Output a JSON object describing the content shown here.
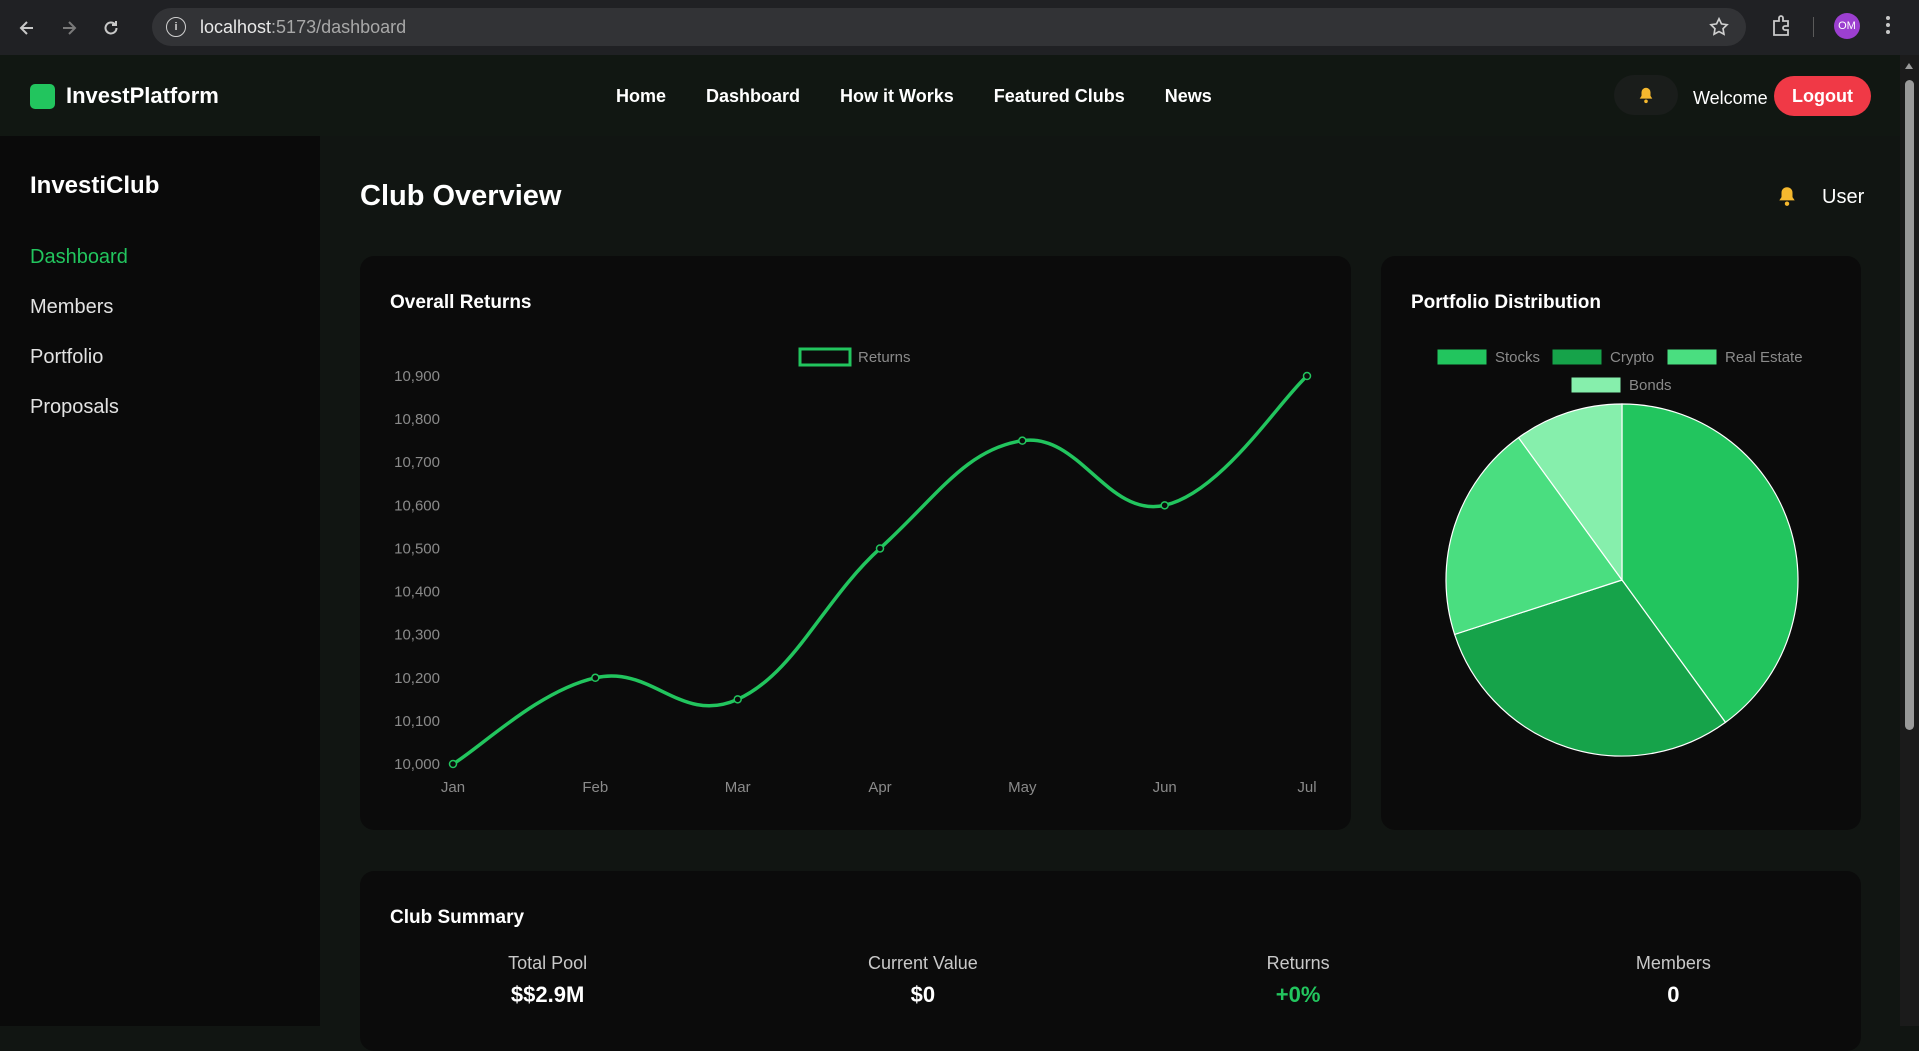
{
  "browser": {
    "url_host": "localhost",
    "url_path": ":5173/dashboard",
    "avatar_initials": "OM"
  },
  "topbar": {
    "brand": "InvestPlatform",
    "nav": [
      "Home",
      "Dashboard",
      "How it Works",
      "Featured Clubs",
      "News"
    ],
    "welcome": "Welcome",
    "logout": "Logout"
  },
  "sidebar": {
    "title": "InvestiClub",
    "items": [
      {
        "label": "Dashboard",
        "active": true
      },
      {
        "label": "Members",
        "active": false
      },
      {
        "label": "Portfolio",
        "active": false
      },
      {
        "label": "Proposals",
        "active": false
      }
    ]
  },
  "main": {
    "title": "Club Overview",
    "user": "User"
  },
  "returns_card": {
    "title": "Overall Returns"
  },
  "pie_card": {
    "title": "Portfolio Distribution"
  },
  "summary": {
    "title": "Club Summary",
    "stats": [
      {
        "label": "Total Pool",
        "value": "$$2.9M"
      },
      {
        "label": "Current Value",
        "value": "$0"
      },
      {
        "label": "Returns",
        "value": "+0%"
      },
      {
        "label": "Members",
        "value": "0"
      }
    ]
  },
  "colors": {
    "accent": "#22c55e",
    "logout": "#f03946",
    "bell": "#f5b82e"
  },
  "chart_data": [
    {
      "type": "line",
      "categories": [
        "Jan",
        "Feb",
        "Mar",
        "Apr",
        "May",
        "Jun",
        "Jul"
      ],
      "series": [
        {
          "name": "Returns",
          "values": [
            10000,
            10200,
            10150,
            10500,
            10750,
            10600,
            10900
          ],
          "color": "#22c55e"
        }
      ],
      "ylim": [
        10000,
        10900
      ],
      "yticks": [
        "10,000",
        "10,100",
        "10,200",
        "10,300",
        "10,400",
        "10,500",
        "10,600",
        "10,700",
        "10,800",
        "10,900"
      ],
      "legend": "top",
      "grid": false
    },
    {
      "type": "pie",
      "labels": [
        "Stocks",
        "Crypto",
        "Real Estate",
        "Bonds"
      ],
      "values": [
        40,
        30,
        20,
        10
      ],
      "colors": [
        "#22c55e",
        "#16a34a",
        "#4ade80",
        "#86efac"
      ],
      "legend": "top"
    }
  ]
}
